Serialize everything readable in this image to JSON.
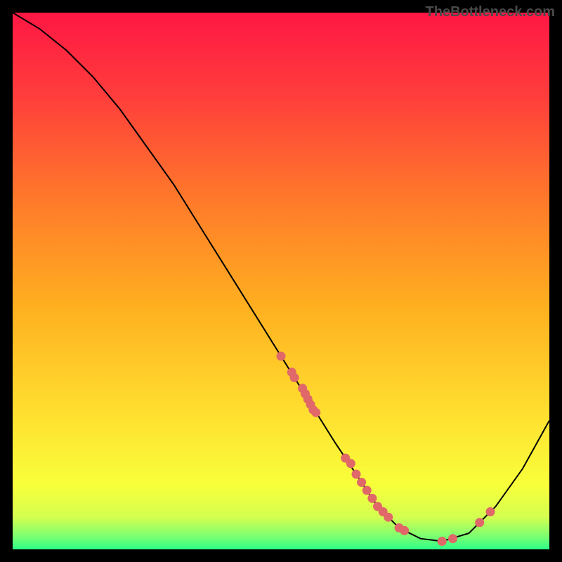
{
  "watermark": "TheBottleneck.com",
  "chart_data": {
    "type": "line",
    "title": "",
    "xlabel": "",
    "ylabel": "",
    "xlim": [
      0,
      100
    ],
    "ylim": [
      0,
      100
    ],
    "curve": {
      "x": [
        0,
        5,
        10,
        15,
        20,
        25,
        30,
        35,
        40,
        45,
        50,
        55,
        60,
        62,
        64,
        66,
        68,
        70,
        72,
        74,
        76,
        80,
        85,
        90,
        95,
        100
      ],
      "y": [
        100,
        97,
        93,
        88,
        82,
        75,
        68,
        60,
        52,
        44,
        36,
        28,
        20,
        17,
        14,
        11,
        8,
        6,
        4,
        3,
        2,
        1.5,
        3,
        8,
        15,
        24
      ]
    },
    "points": {
      "x": [
        50,
        52,
        52.5,
        54,
        54.5,
        55,
        55.5,
        56,
        56.5,
        62,
        63,
        64,
        65,
        66,
        67,
        68,
        69,
        70,
        72,
        73,
        80,
        82,
        87,
        89
      ],
      "y": [
        36,
        33,
        32,
        30,
        29,
        28,
        27,
        26,
        25.5,
        17,
        16,
        14,
        12.5,
        11,
        9.5,
        8,
        7,
        6,
        4,
        3.5,
        1.5,
        2,
        5,
        7
      ]
    },
    "gradient_stops": [
      {
        "offset": 0.0,
        "color": "#ff1744"
      },
      {
        "offset": 0.15,
        "color": "#ff3c3c"
      },
      {
        "offset": 0.35,
        "color": "#ff7a2a"
      },
      {
        "offset": 0.55,
        "color": "#ffb020"
      },
      {
        "offset": 0.75,
        "color": "#ffe030"
      },
      {
        "offset": 0.88,
        "color": "#f8ff3a"
      },
      {
        "offset": 0.94,
        "color": "#d4ff50"
      },
      {
        "offset": 0.975,
        "color": "#7dff70"
      },
      {
        "offset": 1.0,
        "color": "#2cff87"
      }
    ],
    "point_color": "#e06868",
    "curve_color": "#000000"
  }
}
